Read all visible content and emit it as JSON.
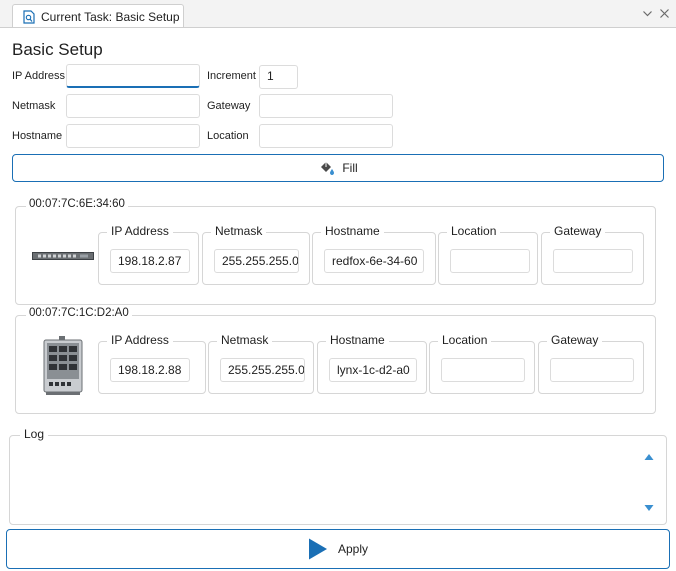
{
  "tab": {
    "title": "Current Task: Basic Setup"
  },
  "form": {
    "title": "Basic Setup",
    "ip_label": "IP Address",
    "ip_value": "",
    "increment_label": "Increment",
    "increment_value": "1",
    "netmask_label": "Netmask",
    "netmask_value": "",
    "gateway_label": "Gateway",
    "gateway_value": "",
    "hostname_label": "Hostname",
    "hostname_value": "",
    "location_label": "Location",
    "location_value": "",
    "fill_label": "Fill"
  },
  "devices": [
    {
      "mac": "00:07:7C:6E:34:60",
      "ip_label": "IP Address",
      "ip": "198.18.2.87",
      "netmask_label": "Netmask",
      "netmask": "255.255.255.0",
      "hostname_label": "Hostname",
      "hostname": "redfox-6e-34-60",
      "location_label": "Location",
      "location": "",
      "gateway_label": "Gateway",
      "gateway": ""
    },
    {
      "mac": "00:07:7C:1C:D2:A0",
      "ip_label": "IP Address",
      "ip": "198.18.2.88",
      "netmask_label": "Netmask",
      "netmask": "255.255.255.0",
      "hostname_label": "Hostname",
      "hostname": "lynx-1c-d2-a0",
      "location_label": "Location",
      "location": "",
      "gateway_label": "Gateway",
      "gateway": ""
    }
  ],
  "log": {
    "label": "Log",
    "content": ""
  },
  "apply": {
    "label": "Apply"
  },
  "colors": {
    "accent": "#1a6fb5",
    "border": "#d6d6d6",
    "scroll_arrow": "#3a8fd0"
  }
}
